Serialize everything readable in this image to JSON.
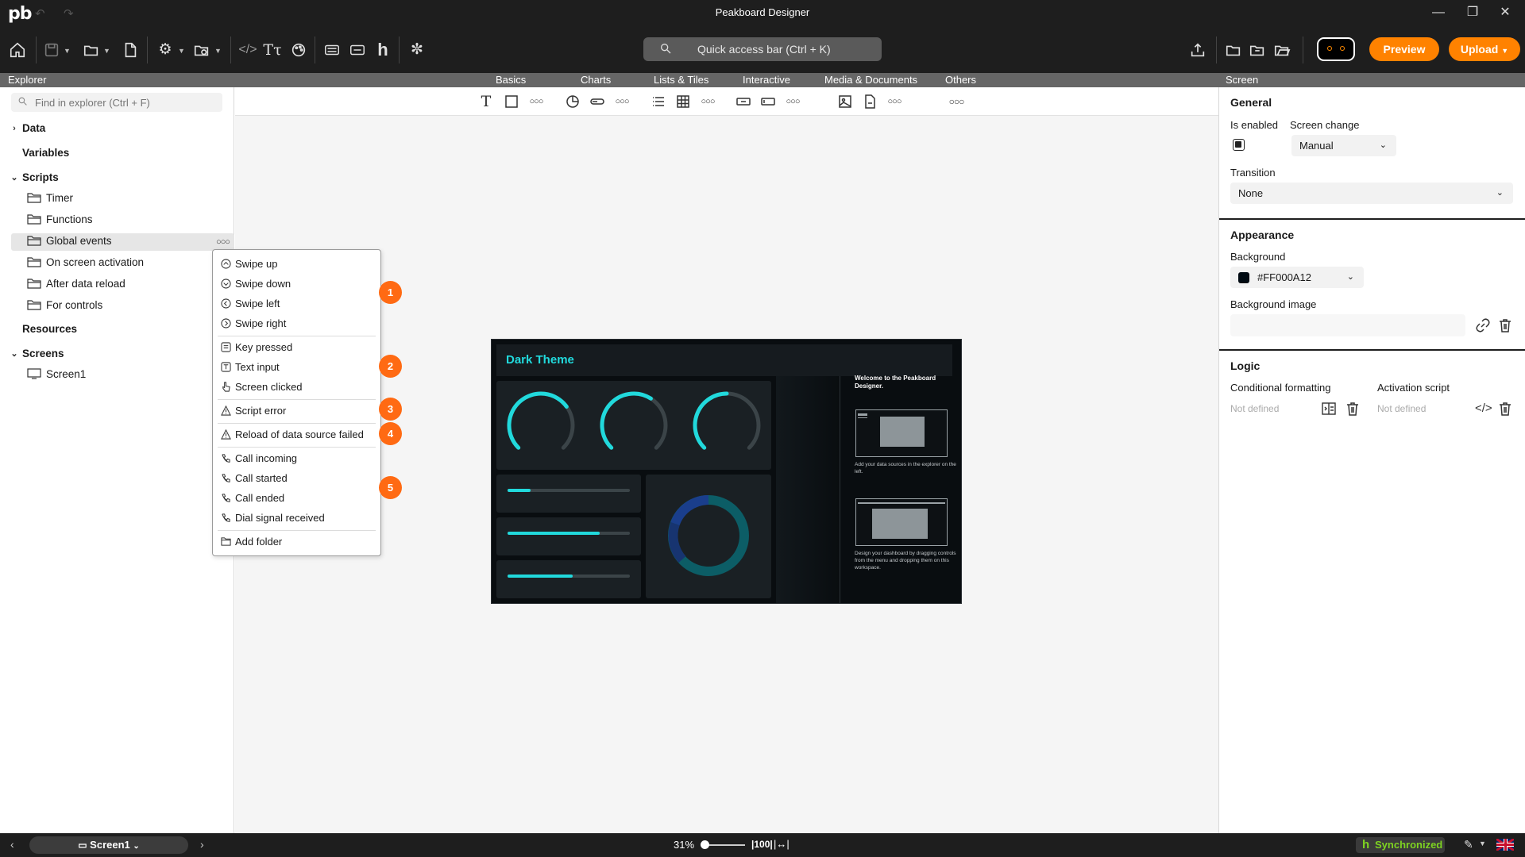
{
  "app": {
    "logo": "pb",
    "title": "Peakboard Designer"
  },
  "toolbar": {
    "quick_access": "Quick access bar (Ctrl + K)",
    "preview_label": "Preview",
    "upload_label": "Upload"
  },
  "headers": {
    "explorer": "Explorer",
    "screen": "Screen"
  },
  "categories": [
    "Basics",
    "Charts",
    "Lists & Tiles",
    "Interactive",
    "Media & Documents",
    "Others"
  ],
  "explorer": {
    "search_placeholder": "Find in explorer (Ctrl + F)",
    "data": "Data",
    "variables": "Variables",
    "scripts": "Scripts",
    "script_items": [
      "Timer",
      "Functions",
      "Global events",
      "On screen activation",
      "After data reload",
      "For controls"
    ],
    "resources": "Resources",
    "screens": "Screens",
    "screen_items": [
      "Screen1"
    ]
  },
  "context_menu": {
    "items": [
      "Swipe up",
      "Swipe down",
      "Swipe left",
      "Swipe right",
      "Key pressed",
      "Text input",
      "Screen clicked",
      "Script error",
      "Reload of data source failed",
      "Call incoming",
      "Call started",
      "Call ended",
      "Dial signal received",
      "Add folder"
    ],
    "badges": [
      "1",
      "2",
      "3",
      "4",
      "5"
    ]
  },
  "preview": {
    "title": "Dark Theme",
    "welcome": "Welcome to the Peakboard Designer.",
    "hint1": "Add your data sources in the explorer on the left.",
    "hint2": "Design your dashboard by dragging controls from the menu and dropping them on this workspace.",
    "accent": "#21d9dc",
    "bar_levels": [
      0.19,
      0.75,
      0.53
    ],
    "gauge_levels": [
      0.7,
      0.62,
      0.5
    ]
  },
  "properties": {
    "general": "General",
    "is_enabled": "Is enabled",
    "screen_change": "Screen change",
    "screen_change_value": "Manual",
    "transition": "Transition",
    "transition_value": "None",
    "appearance": "Appearance",
    "background": "Background",
    "background_value": "#FF000A12",
    "background_swatch": "#000a12",
    "background_image": "Background image",
    "logic": "Logic",
    "conditional_formatting": "Conditional formatting",
    "activation_script": "Activation script",
    "not_defined_1": "Not defined",
    "not_defined_2": "Not defined"
  },
  "statusbar": {
    "screen": "Screen1",
    "zoom": "31%",
    "sync": "Synchronized"
  },
  "colors": {
    "accent_orange": "#ff8200",
    "badge_orange": "#ff6a13",
    "sync_green": "#7ed321"
  }
}
